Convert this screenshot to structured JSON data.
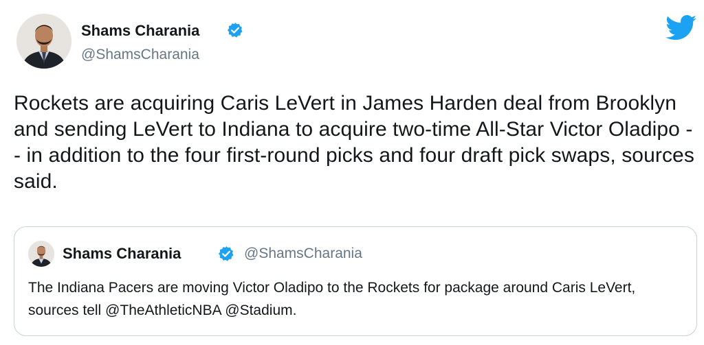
{
  "tweet": {
    "author": {
      "name": "Shams Charania",
      "handle": "@ShamsCharania",
      "verified": true
    },
    "text": "Rockets are acquiring Caris LeVert in James Harden deal from Brooklyn and sending LeVert to Indiana to acquire two-time All-Star Victor Oladipo -- in addition to the four first-round picks and four draft pick swaps, sources said.",
    "icons": {
      "brand": "twitter-bird-icon",
      "verified": "verified-badge-icon"
    },
    "quoted_tweet": {
      "author": {
        "name": "Shams Charania",
        "handle": "@ShamsCharania",
        "verified": true
      },
      "text": "The Indiana Pacers are moving Victor Oladipo to the Rockets for package around Caris LeVert, sources tell @TheAthleticNBA @Stadium."
    }
  },
  "colors": {
    "twitter_blue": "#1da1f2",
    "text_primary": "#14171a",
    "text_secondary": "#657786",
    "border": "#c9d1d8"
  }
}
